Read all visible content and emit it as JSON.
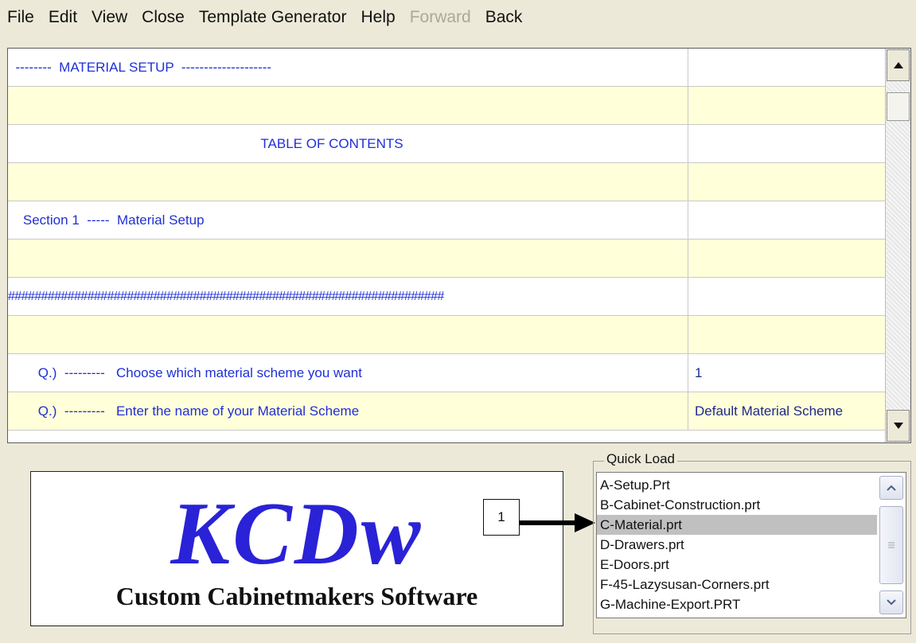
{
  "menu": [
    {
      "label": "File",
      "enabled": true
    },
    {
      "label": "Edit",
      "enabled": true
    },
    {
      "label": "View",
      "enabled": true
    },
    {
      "label": "Close",
      "enabled": true
    },
    {
      "label": "Template Generator",
      "enabled": true
    },
    {
      "label": "Help",
      "enabled": true
    },
    {
      "label": "Forward",
      "enabled": false
    },
    {
      "label": "Back",
      "enabled": true
    }
  ],
  "grid": {
    "rows": [
      {
        "text": "  --------  MATERIAL SETUP  --------------------",
        "value": ""
      },
      {
        "text": "",
        "value": ""
      },
      {
        "text": "TABLE OF CONTENTS",
        "value": ""
      },
      {
        "text": "",
        "value": ""
      },
      {
        "text": "    Section 1  -----  Material Setup",
        "value": ""
      },
      {
        "text": "",
        "value": ""
      },
      {
        "text": "##################################################################",
        "value": ""
      },
      {
        "text": "",
        "value": ""
      },
      {
        "text": "        Q.)  ---------   Choose which material scheme you want",
        "value": "1"
      },
      {
        "text": "        Q.)  ---------   Enter the name of your Material Scheme",
        "value": "Default Material Scheme"
      }
    ]
  },
  "logo": {
    "title": "KCDw",
    "subtitle": "Custom Cabinetmakers Software"
  },
  "callout": {
    "number": "1"
  },
  "quick_load": {
    "legend": "Quick Load",
    "items": [
      "A-Setup.Prt",
      "B-Cabinet-Construction.prt",
      "C-Material.prt",
      "D-Drawers.prt",
      "E-Doors.prt",
      "F-45-Lazysusan-Corners.prt",
      "G-Machine-Export.PRT"
    ],
    "selected": "C-Material.prt"
  },
  "icons": [
    "scroll-up-icon",
    "scroll-down-icon",
    "arrow-right-icon",
    "grip-icon"
  ],
  "colors": {
    "row_alt": "#ffffd9",
    "grid_text": "#1f2fd8",
    "logo_blue": "#2a22d6",
    "selection": "#c0c0c0"
  }
}
